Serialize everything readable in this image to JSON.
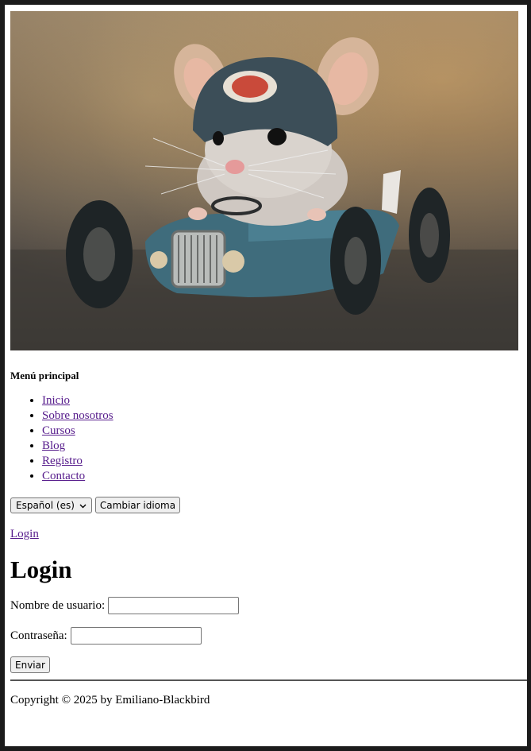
{
  "hero": {
    "image_icon": "mouse-racing-car-photo"
  },
  "menu": {
    "title": "Menú principal",
    "items": [
      {
        "label": "Inicio"
      },
      {
        "label": "Sobre nosotros"
      },
      {
        "label": "Cursos"
      },
      {
        "label": "Blog"
      },
      {
        "label": "Registro"
      },
      {
        "label": "Contacto"
      }
    ]
  },
  "language": {
    "selected": "Español (es)",
    "change_button": "Cambiar idioma"
  },
  "login_link": "Login",
  "page_title": "Login",
  "form": {
    "username_label": "Nombre de usuario:",
    "username_value": "",
    "password_label": "Contraseña:",
    "password_value": "",
    "submit": "Enviar"
  },
  "footer": {
    "copyright": "Copyright © 2025 by Emiliano-Blackbird"
  }
}
